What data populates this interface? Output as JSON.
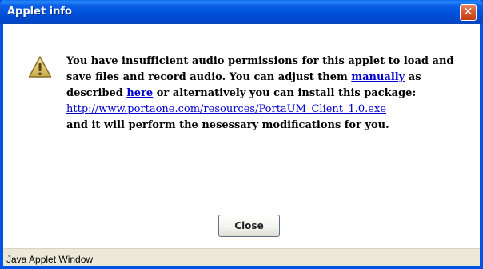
{
  "window": {
    "title": "Applet info",
    "close_glyph": "✕"
  },
  "message": {
    "line1": "You have insufficient audio permissions for this applet to load and",
    "line2_prefix": "save files and record audio. You can adjust them ",
    "link_manually": "manually",
    "line2_suffix": " as",
    "line3_prefix": "described ",
    "link_here": "here",
    "line3_suffix": " or alternatively you can install this package:",
    "url": "http://www.portaone.com/resources/PortaUM_Client_1.0.exe",
    "line5": "and it will perform the nesessary modifications for you."
  },
  "buttons": {
    "close_label": "Close"
  },
  "status": {
    "text": "Java Applet Window"
  },
  "icons": {
    "warning": "warning-icon"
  },
  "colors": {
    "titlebar": "#0054e3",
    "link": "#0000cc",
    "close_button": "#d95a2f"
  }
}
